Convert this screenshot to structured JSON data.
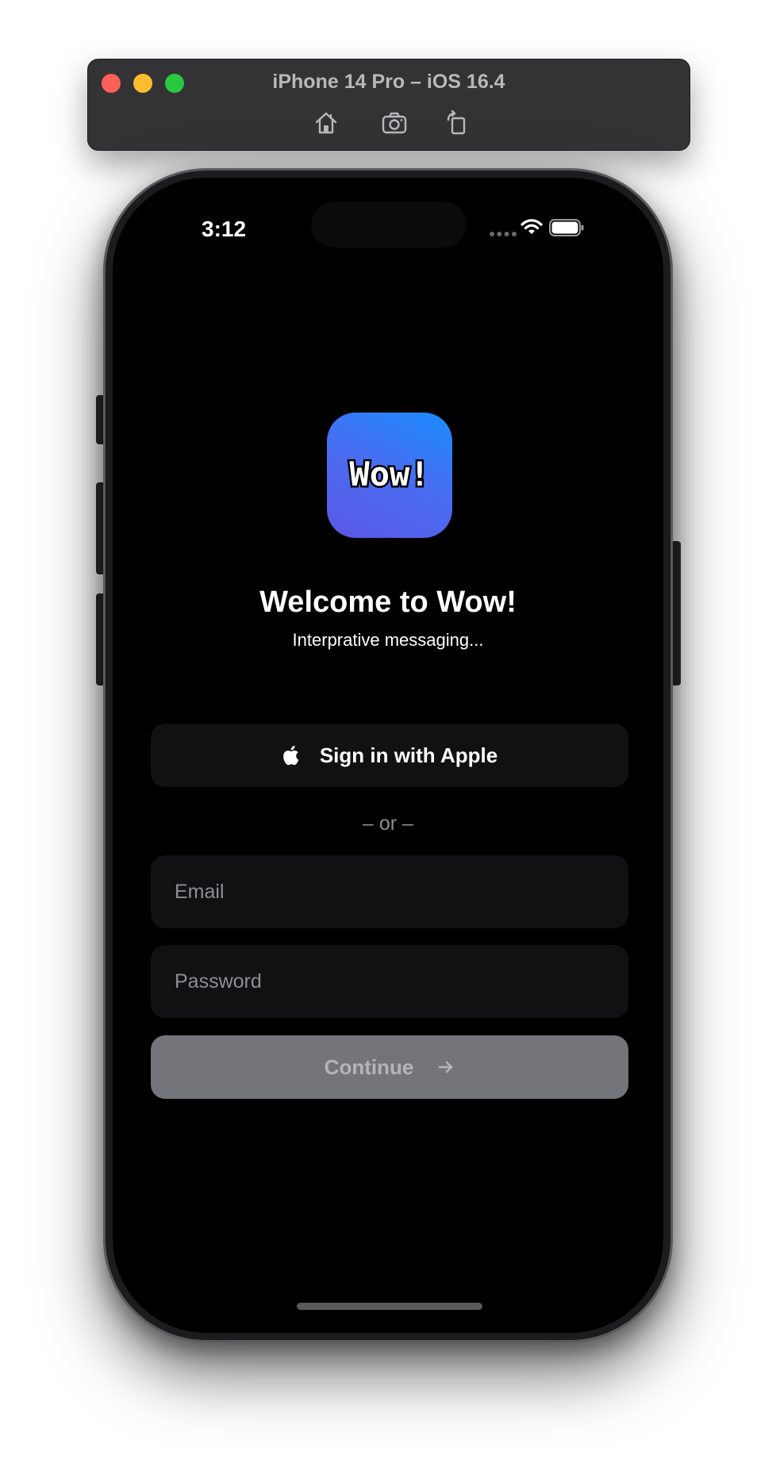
{
  "simulator": {
    "title": "iPhone 14 Pro – iOS 16.4",
    "tools": [
      "home-icon",
      "screenshot-icon",
      "rotate-icon"
    ]
  },
  "status_bar": {
    "time": "3:12",
    "icons": [
      "signal-dots-icon",
      "wifi-icon",
      "battery-icon"
    ]
  },
  "app": {
    "icon_text": "Wow!",
    "icon_colors": [
      "#1a8cff",
      "#5a57e6"
    ],
    "welcome_title": "Welcome to Wow!",
    "subtitle": "Interprative messaging..."
  },
  "apple_signin": {
    "label": "Sign in with Apple",
    "icon": "apple-logo-icon"
  },
  "separator": "– or –",
  "email": {
    "placeholder": "Email",
    "value": ""
  },
  "password": {
    "placeholder": "Password",
    "value": ""
  },
  "continue_button": {
    "label": "Continue",
    "icon": "arrow-right-icon",
    "enabled": false
  },
  "colors": {
    "screen_bg": "#000000",
    "field_bg": "#111113",
    "continue_bg": "#74747b",
    "placeholder": "#8e8e93"
  }
}
